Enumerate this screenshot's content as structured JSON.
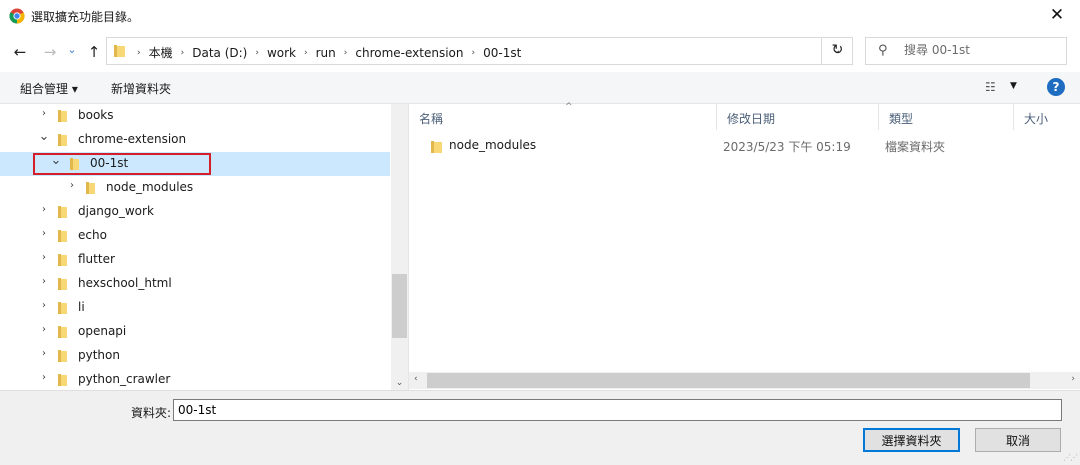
{
  "window": {
    "title": "選取擴充功能目錄。",
    "close_glyph": "✕"
  },
  "nav": {
    "back_glyph": "←",
    "forward_glyph": "→",
    "recent_glyph": "⌄",
    "up_glyph": "↑"
  },
  "address": {
    "crumbs": [
      "本機",
      "Data (D:)",
      "work",
      "run",
      "chrome-extension",
      "00-1st"
    ],
    "dropdown_glyph": "⌄",
    "refresh_glyph": "↻"
  },
  "search": {
    "placeholder": "搜尋 00-1st",
    "icon_glyph": "⚲"
  },
  "toolbar": {
    "organize_label": "組合管理 ▾",
    "new_folder_label": "新增資料夾",
    "view_glyph": "☷",
    "view_dd_glyph": "▼",
    "help_glyph": "?"
  },
  "tree": {
    "items": [
      {
        "label": "books",
        "level": 0,
        "chevron": "›",
        "selected": false
      },
      {
        "label": "chrome-extension",
        "level": 0,
        "chevron": "⌄",
        "selected": false
      },
      {
        "label": "00-1st",
        "level": 1,
        "chevron": "⌄",
        "selected": true
      },
      {
        "label": "node_modules",
        "level": 2,
        "chevron": "›",
        "selected": false
      },
      {
        "label": "django_work",
        "level": 0,
        "chevron": "›",
        "selected": false
      },
      {
        "label": "echo",
        "level": 0,
        "chevron": "›",
        "selected": false
      },
      {
        "label": "flutter",
        "level": 0,
        "chevron": "›",
        "selected": false
      },
      {
        "label": "hexschool_html",
        "level": 0,
        "chevron": "›",
        "selected": false
      },
      {
        "label": "li",
        "level": 0,
        "chevron": "›",
        "selected": false
      },
      {
        "label": "openapi",
        "level": 0,
        "chevron": "›",
        "selected": false
      },
      {
        "label": "python",
        "level": 0,
        "chevron": "›",
        "selected": false
      },
      {
        "label": "python_crawler",
        "level": 0,
        "chevron": "›",
        "selected": false
      }
    ]
  },
  "list": {
    "columns": [
      "名稱",
      "修改日期",
      "類型",
      "大小"
    ],
    "sort_glyph": "^",
    "rows": [
      {
        "name": "node_modules",
        "modified": "2023/5/23 下午 05:19",
        "type": "檔案資料夾",
        "size": ""
      }
    ]
  },
  "footer": {
    "folder_label": "資料夾:",
    "folder_value": "00-1st",
    "select_button": "選擇資料夾",
    "cancel_button": "取消"
  },
  "colors": {
    "selection": "#cce8ff",
    "highlight_border": "#d21f2a",
    "folder_yellow": "#f8d775",
    "accent": "#0078d7"
  }
}
